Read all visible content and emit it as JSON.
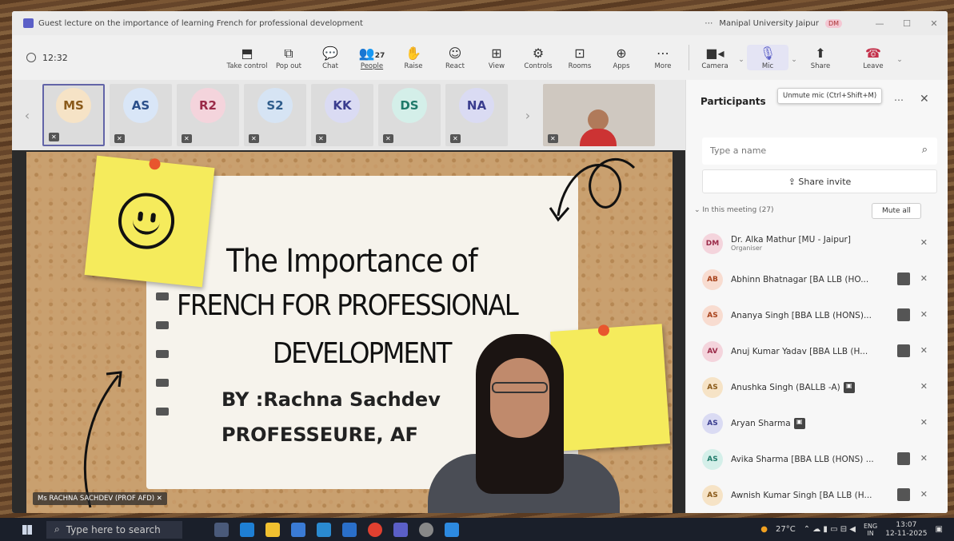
{
  "window": {
    "title": "Guest lecture on the importance of learning French for professional development",
    "org": "Manipal University Jaipur",
    "org_badge": "DM",
    "controls": [
      "—",
      "☐",
      "✕"
    ]
  },
  "toolbar": {
    "time": "12:32",
    "buttons": [
      {
        "label": "Take control",
        "icon": "⬒"
      },
      {
        "label": "Pop out",
        "icon": "⧉"
      },
      {
        "label": "Chat",
        "icon": "💬"
      },
      {
        "label": "People",
        "icon": "👥",
        "count": "27"
      },
      {
        "label": "Raise",
        "icon": "✋"
      },
      {
        "label": "React",
        "icon": "☺"
      },
      {
        "label": "View",
        "icon": "⊞"
      },
      {
        "label": "Controls",
        "icon": "⚙"
      },
      {
        "label": "Rooms",
        "icon": "⊡"
      },
      {
        "label": "Apps",
        "icon": "⊕"
      },
      {
        "label": "More",
        "icon": "⋯"
      }
    ],
    "camera_label": "Camera",
    "mic_label": "Mic",
    "share_label": "Share",
    "leave_label": "Leave",
    "tooltip": "Unmute mic (Ctrl+Shift+M)"
  },
  "tiles": [
    {
      "initials": "MS",
      "bg": "#f6e3c6",
      "fg": "#8a5a1a"
    },
    {
      "initials": "AS",
      "bg": "#d9e6f7",
      "fg": "#2b4f8a"
    },
    {
      "initials": "R2",
      "bg": "#f4d4dc",
      "fg": "#9a2a48"
    },
    {
      "initials": "S2",
      "bg": "#d6e4f4",
      "fg": "#2f5d8c"
    },
    {
      "initials": "KK",
      "bg": "#dadbf3",
      "fg": "#3a3d8f"
    },
    {
      "initials": "DS",
      "bg": "#d4efe9",
      "fg": "#1f7a6a"
    },
    {
      "initials": "NA",
      "bg": "#dadbf3",
      "fg": "#3a3d8f"
    }
  ],
  "slide": {
    "line1": "The Importance of",
    "line2": "FRENCH FOR PROFESSIONAL",
    "line3": "DEVELOPMENT",
    "line4": "BY :Rachna Sachdev",
    "line5": "PROFESSEURE, AF"
  },
  "presenter_name": "Ms RACHNA SACHDEV (PROF AFD)",
  "panel": {
    "title": "Participants",
    "search_placeholder": "Type a name",
    "share_invite": "Share invite",
    "in_meeting": "In this meeting (27)",
    "mute_all": "Mute all",
    "participants": [
      {
        "initials": "DM",
        "name": "Dr. Alka Mathur [MU - Jaipur]",
        "role": "Organiser",
        "bg": "#f4d4dc",
        "fg": "#9a2a48"
      },
      {
        "initials": "AB",
        "name": "Abhinn Bhatnagar [BA LLB (HO...",
        "role": "",
        "bg": "#f8dcd0",
        "fg": "#a8431c"
      },
      {
        "initials": "AS",
        "name": "Ananya Singh [BBA LLB (HONS)...",
        "role": "",
        "bg": "#f8dcd0",
        "fg": "#a8431c"
      },
      {
        "initials": "AV",
        "name": "Anuj Kumar Yadav [BBA LLB (H...",
        "role": "",
        "bg": "#f4d4dc",
        "fg": "#9a2a48"
      },
      {
        "initials": "AS",
        "name": "Anushka Singh (BALLB -A)",
        "role": "",
        "bg": "#f6e3c6",
        "fg": "#8a5a1a"
      },
      {
        "initials": "AS",
        "name": "Aryan Sharma",
        "role": "",
        "bg": "#dadbf3",
        "fg": "#3a3d8f"
      },
      {
        "initials": "AS",
        "name": "Avika Sharma [BBA LLB (HONS) ...",
        "role": "",
        "bg": "#d4efe9",
        "fg": "#1f7a6a"
      },
      {
        "initials": "AS",
        "name": "Awnish Kumar Singh [BA LLB (H...",
        "role": "",
        "bg": "#f6e3c6",
        "fg": "#8a5a1a"
      }
    ]
  },
  "taskbar": {
    "search_placeholder": "Type here to search",
    "temp": "27°C",
    "lang1": "ENG",
    "lang2": "IN",
    "time": "13:07",
    "date": "12-11-2025"
  }
}
